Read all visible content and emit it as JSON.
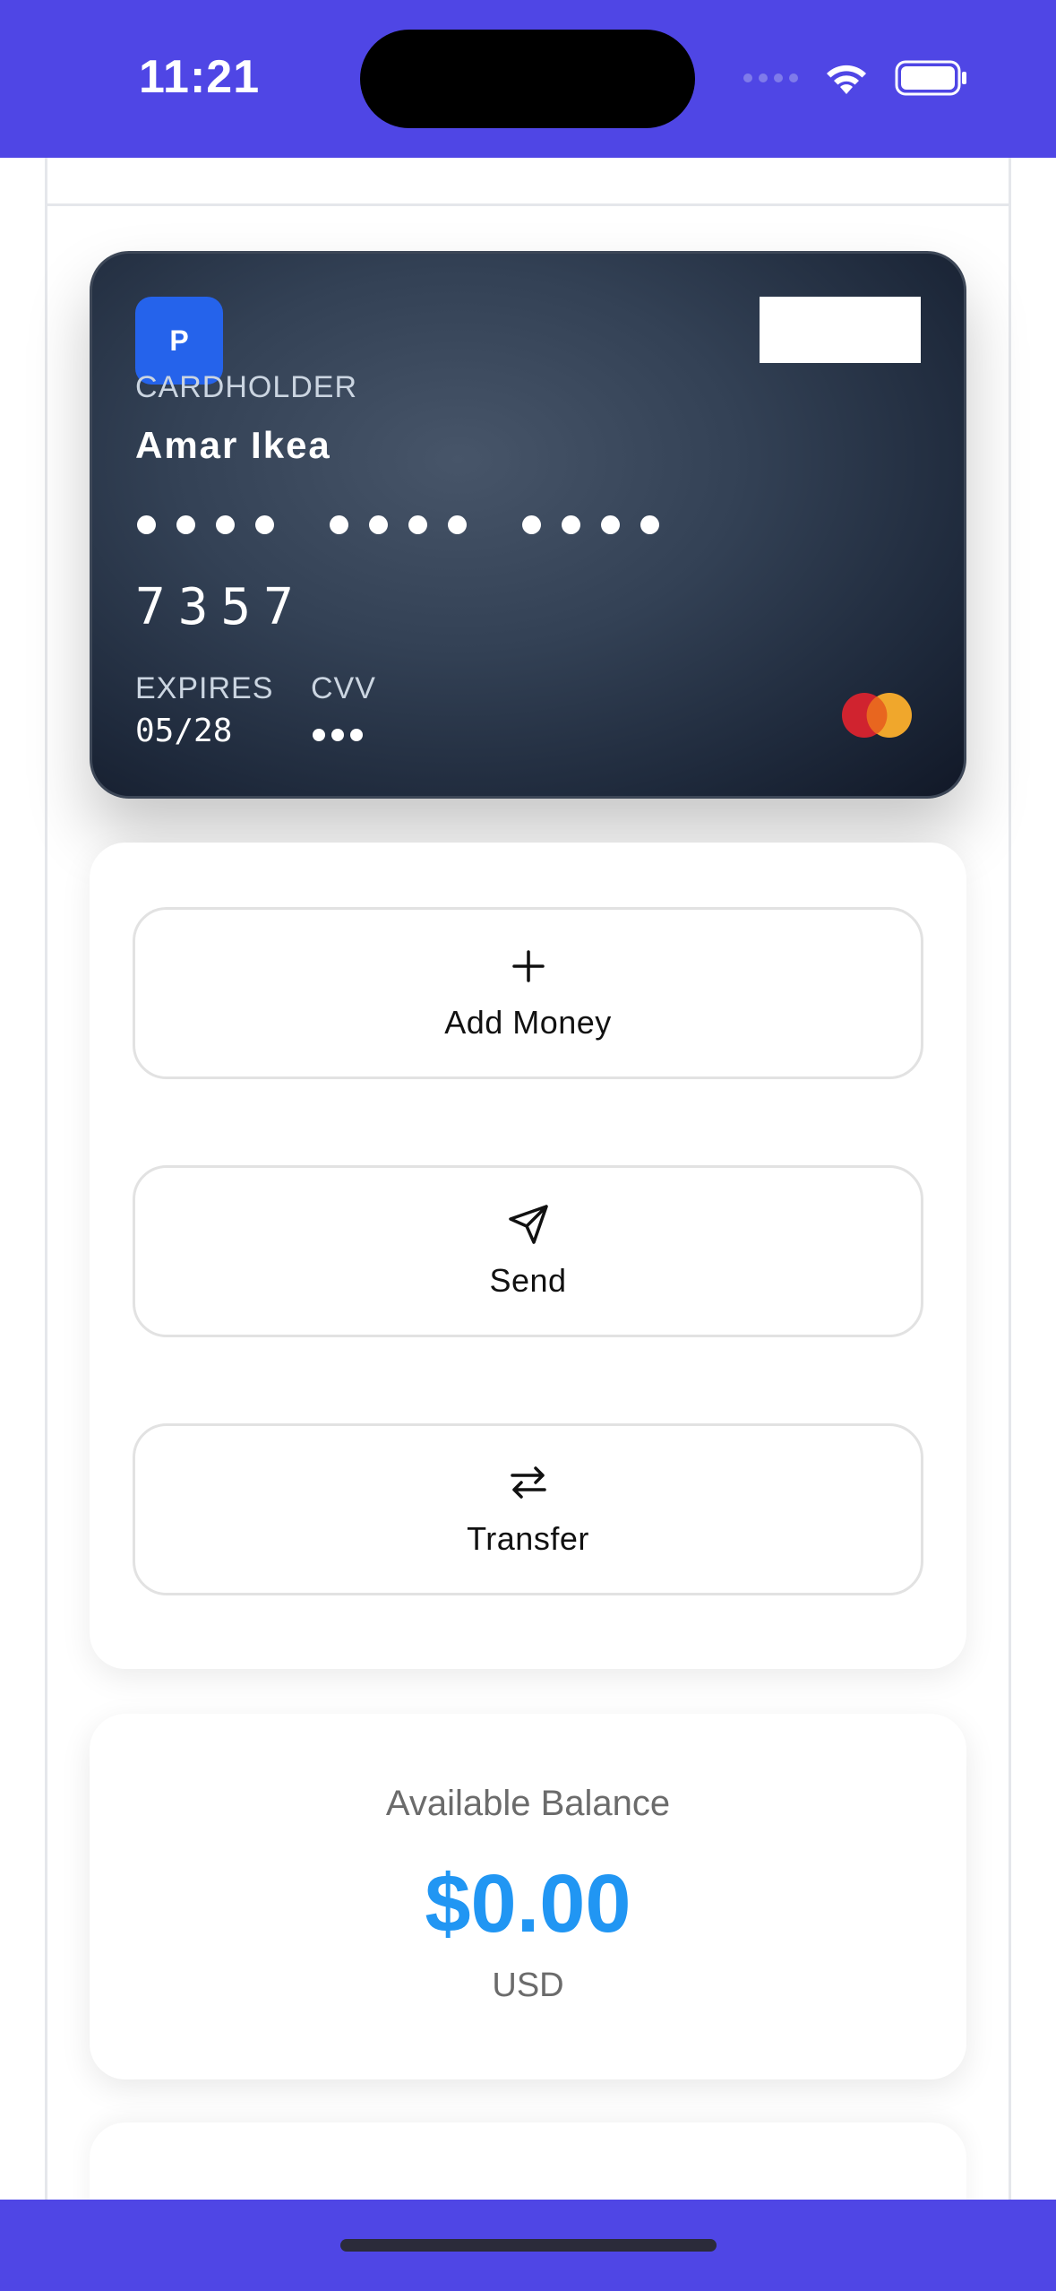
{
  "status_bar": {
    "time": "11:21",
    "background_color": "#4f46e5"
  },
  "card": {
    "brand_initial": "P",
    "cardholder_label": "CARDHOLDER",
    "cardholder_name": "Amar Ikea",
    "last4": "7357",
    "expires_label": "EXPIRES",
    "expires_value": "05/28",
    "cvv_label": "CVV",
    "network": "mastercard-logo",
    "brand_color": "#2563eb"
  },
  "actions": {
    "add_money": {
      "label": "Add Money",
      "icon": "plus-icon"
    },
    "send": {
      "label": "Send",
      "icon": "send-icon"
    },
    "transfer": {
      "label": "Transfer",
      "icon": "transfer-icon"
    }
  },
  "balance": {
    "label": "Available Balance",
    "amount": "$0.00",
    "currency": "USD",
    "amount_color": "#2196f3"
  }
}
